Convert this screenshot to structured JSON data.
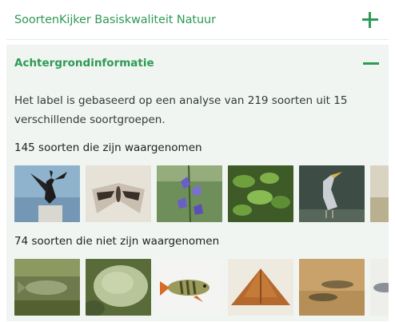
{
  "header": {
    "title": "SoortenKijker Basiskwaliteit Natuur",
    "expand_icon": "plus-icon"
  },
  "section": {
    "title": "Achtergrondinformatie",
    "collapse_icon": "minus-icon",
    "description": "Het label is gebaseerd op een analyse van 219 soorten uit 15 verschillende soortgroepen."
  },
  "observed": {
    "label": "145 soorten die zijn waargenomen",
    "photos": [
      "cormorant-photo",
      "moth-photo",
      "bellflower-photo",
      "plant-photo",
      "heron-photo",
      "partial-photo"
    ]
  },
  "not_observed": {
    "label": "74 soorten die niet zijn waargenomen",
    "photos": [
      "fish-underwater-photo",
      "lichen-photo",
      "perch-photo",
      "brown-moth-photo",
      "fish-sand-photo",
      "partial-fish-photo"
    ]
  },
  "colors": {
    "accent": "#2e9a55",
    "panel_bg": "#f0f5f1"
  }
}
